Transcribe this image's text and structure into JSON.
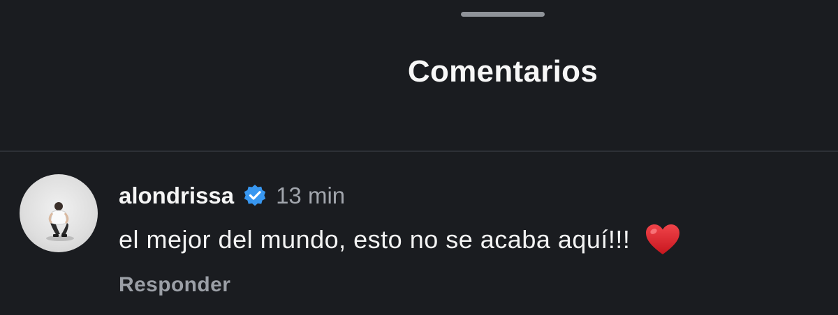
{
  "header": {
    "title": "Comentarios"
  },
  "comment": {
    "username": "alondrissa",
    "verified_icon": "verified-badge-icon",
    "time": "13 min",
    "text": "el mejor del mundo, esto no se acaba aquí!!!",
    "emoji_icon": "red-heart-icon",
    "reply_label": "Responder"
  },
  "colors": {
    "background": "#1a1c20",
    "verified_blue": "#3897f0",
    "heart_red": "#e0242b",
    "muted_text": "#a2a6ad"
  }
}
